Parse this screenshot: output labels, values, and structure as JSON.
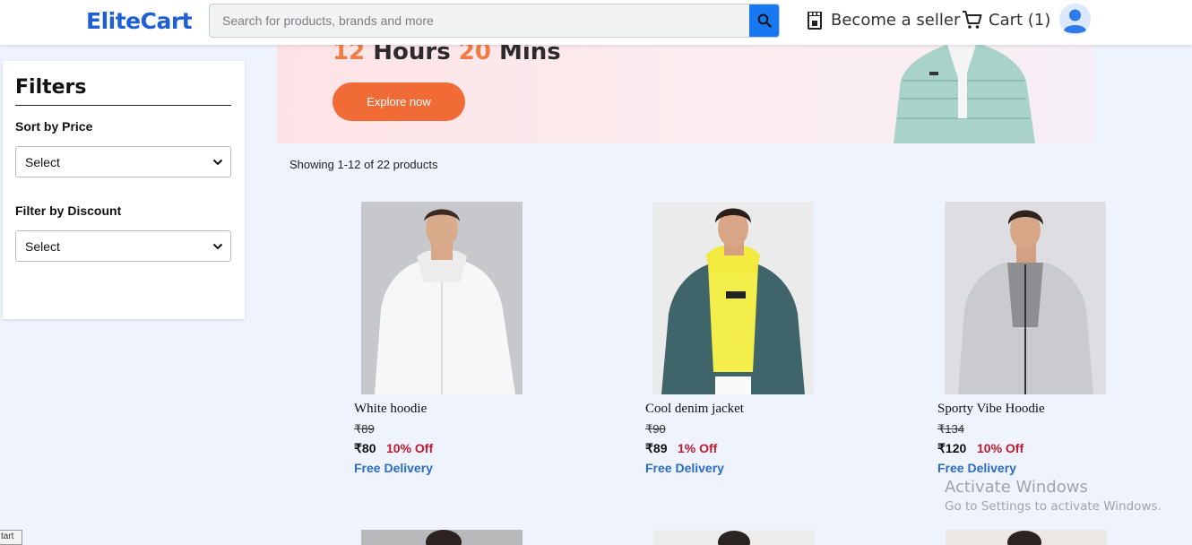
{
  "header": {
    "logo": "EliteCart",
    "search_placeholder": "Search for products, brands and more",
    "seller_label": "Become a seller",
    "cart_label": "Cart (1)"
  },
  "sidebar": {
    "title": "Filters",
    "sort_label": "Sort by Price",
    "sort_value": "Select",
    "discount_label": "Filter by Discount",
    "discount_value": "Select"
  },
  "banner": {
    "timer_hours": "12",
    "timer_hours_unit": "Hours",
    "timer_mins": "20",
    "timer_mins_unit": "Mins",
    "cta": "Explore now"
  },
  "results": {
    "showing_text": "Showing 1-12 of 22 products"
  },
  "products": [
    {
      "name": "White hoodie",
      "old_price": "₹89",
      "price": "₹80",
      "discount": "10% Off",
      "delivery": "Free Delivery"
    },
    {
      "name": "Cool denim jacket",
      "old_price": "₹90",
      "price": "₹89",
      "discount": "1% Off",
      "delivery": "Free Delivery"
    },
    {
      "name": "Sporty Vibe Hoodie",
      "old_price": "₹134",
      "price": "₹120",
      "discount": "10% Off",
      "delivery": "Free Delivery"
    }
  ],
  "overlay": {
    "watermark_title": "Activate Windows",
    "watermark_sub": "Go to Settings to activate Windows.",
    "corner_tag": "tart"
  },
  "colors": {
    "brand": "#1f5fd6",
    "search_button": "#1778f2",
    "cta": "#f16b37",
    "discount": "#c0192d",
    "delivery": "#2b6cc4",
    "page_background": "#eef3fd"
  }
}
